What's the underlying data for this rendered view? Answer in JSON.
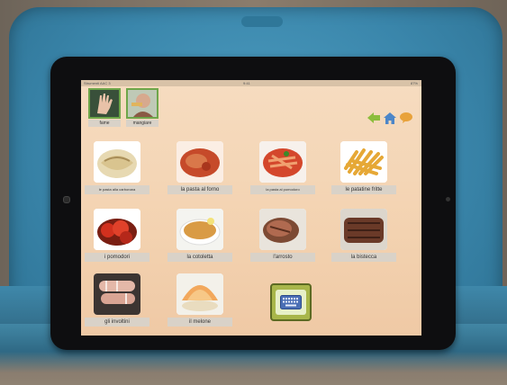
{
  "app": {
    "status_left": "Strumenti AAC 3",
    "status_center": "9:41",
    "status_right": "87%"
  },
  "categories": [
    {
      "label": "fame",
      "icon": "hand-icon"
    },
    {
      "label": "mangiare",
      "icon": "eating-icon"
    }
  ],
  "nav": [
    {
      "name": "back-arrow-icon",
      "color": "#8cbd3c"
    },
    {
      "name": "home-icon",
      "color": "#4c86c8"
    },
    {
      "name": "speech-bubble-icon",
      "color": "#e8a23a"
    }
  ],
  "foods": [
    {
      "label": "le pasta alla carbonara",
      "small": true
    },
    {
      "label": "la pasta al forno",
      "small": false
    },
    {
      "label": "la pasta al pomodoro",
      "small": true
    },
    {
      "label": "le patatine fritte",
      "small": false
    },
    {
      "label": "i pomodori",
      "small": false
    },
    {
      "label": "la cotoletta",
      "small": false
    },
    {
      "label": "l'arrosto",
      "small": false
    },
    {
      "label": "la bistecca",
      "small": false
    },
    {
      "label": "gli involtini",
      "small": false
    },
    {
      "label": "il melone",
      "small": false
    }
  ],
  "keyboard": {
    "icon": "keyboard-icon"
  }
}
